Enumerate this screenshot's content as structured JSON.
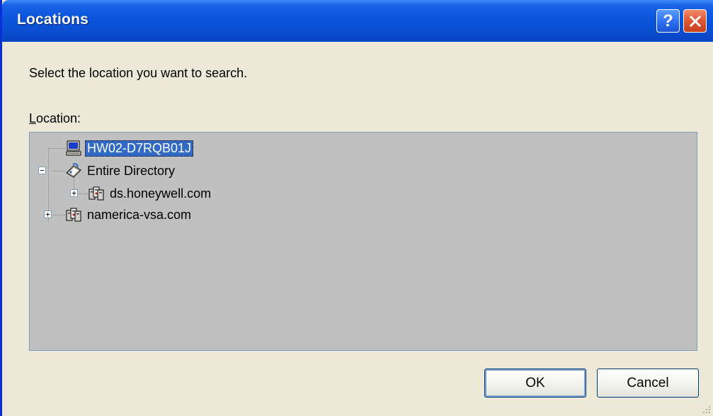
{
  "window": {
    "title": "Locations",
    "help_glyph": "?",
    "close_icon": "close-icon",
    "title_color": "#0a4fd2"
  },
  "dialog": {
    "prompt": "Select the location you want to search.",
    "location_label_first": "L",
    "location_label_rest": "ocation:"
  },
  "tree": {
    "background": "#c0c0c0",
    "items": [
      {
        "label": "HW02-D7RQB01J",
        "icon": "computer-icon",
        "selected": true,
        "expander": ""
      },
      {
        "label": "Entire Directory",
        "icon": "directory-icon",
        "selected": false,
        "expander": "−"
      },
      {
        "label": "ds.honeywell.com",
        "icon": "domain-icon",
        "selected": false,
        "expander": "+"
      },
      {
        "label": "namerica-vsa.com",
        "icon": "domain-icon",
        "selected": false,
        "expander": "+"
      }
    ]
  },
  "buttons": {
    "ok": "OK",
    "cancel": "Cancel"
  }
}
